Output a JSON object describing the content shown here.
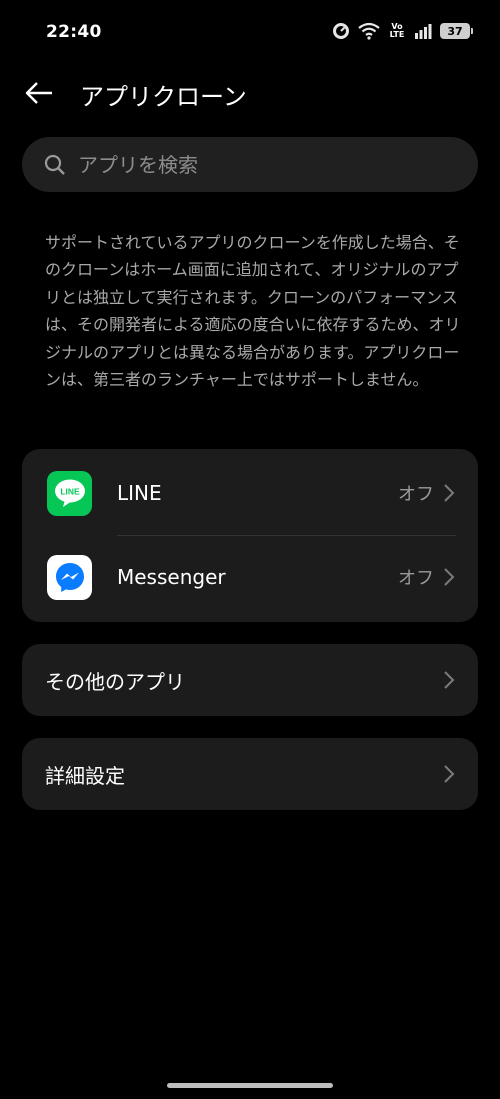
{
  "status_bar": {
    "time": "22:40",
    "battery": "37",
    "network_label_top": "Vo",
    "network_label_bottom": "LTE"
  },
  "header": {
    "title": "アプリクローン"
  },
  "search": {
    "placeholder": "アプリを検索"
  },
  "description": "サポートされているアプリのクローンを作成した場合、そのクローンはホーム画面に追加されて、オリジナルのアプリとは独立して実行されます。クローンのパフォーマンスは、その開発者による適応の度合いに依存するため、オリジナルのアプリとは異なる場合があります。アプリクローンは、第三者のランチャー上ではサポートしません。",
  "apps": [
    {
      "name": "LINE",
      "status": "オフ",
      "icon": "line-icon",
      "icon_text": "LINE"
    },
    {
      "name": "Messenger",
      "status": "オフ",
      "icon": "messenger-icon"
    }
  ],
  "other_apps": {
    "label": "その他のアプリ"
  },
  "advanced": {
    "label": "詳細設定"
  },
  "colors": {
    "background": "#000000",
    "card": "#1c1c1c",
    "line_green": "#06c755",
    "messenger_blue": "#0a7cff"
  }
}
